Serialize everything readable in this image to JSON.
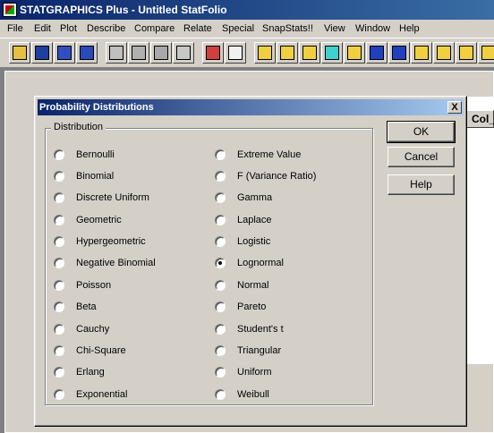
{
  "window": {
    "title": "STATGRAPHICS Plus - Untitled StatFolio"
  },
  "menubar": {
    "items": [
      "File",
      "Edit",
      "Plot",
      "Describe",
      "Compare",
      "Relate",
      "Special",
      "SnapStats!!",
      "View",
      "Window",
      "Help"
    ]
  },
  "toolbar": {
    "icons": [
      "open-folder-icon",
      "save-icon",
      "spreadsheet-icon",
      "save-data-icon",
      "cut-icon",
      "copy-icon",
      "paste-icon",
      "undo-icon",
      "print-icon",
      "print-preview-icon",
      "scatter-plot-icon",
      "box-plot-icon",
      "bar-chart-icon",
      "x-icon",
      "pattern-plot-icon",
      "time-series-icon",
      "distribution-plot-icon",
      "trend-plot-icon",
      "globe-icon",
      "tree-icon",
      "grid-plot-icon"
    ]
  },
  "background": {
    "column_header": "Col_"
  },
  "dialog": {
    "title": "Probability Distributions",
    "close_label": "X",
    "group_label": "Distribution",
    "buttons": {
      "ok": "OK",
      "cancel": "Cancel",
      "help": "Help"
    },
    "left_options": [
      "Bernoulli",
      "Binomial",
      "Discrete Uniform",
      "Geometric",
      "Hypergeometric",
      "Negative Binomial",
      "Poisson",
      "Beta",
      "Cauchy",
      "Chi-Square",
      "Erlang",
      "Exponential"
    ],
    "right_options": [
      "Extreme Value",
      "F (Variance Ratio)",
      "Gamma",
      "Laplace",
      "Logistic",
      "Lognormal",
      "Normal",
      "Pareto",
      "Student's t",
      "Triangular",
      "Uniform",
      "Weibull"
    ],
    "selected": "Lognormal"
  },
  "colors": {
    "title_bar": "#0a246a",
    "face": "#d4d0c8"
  }
}
